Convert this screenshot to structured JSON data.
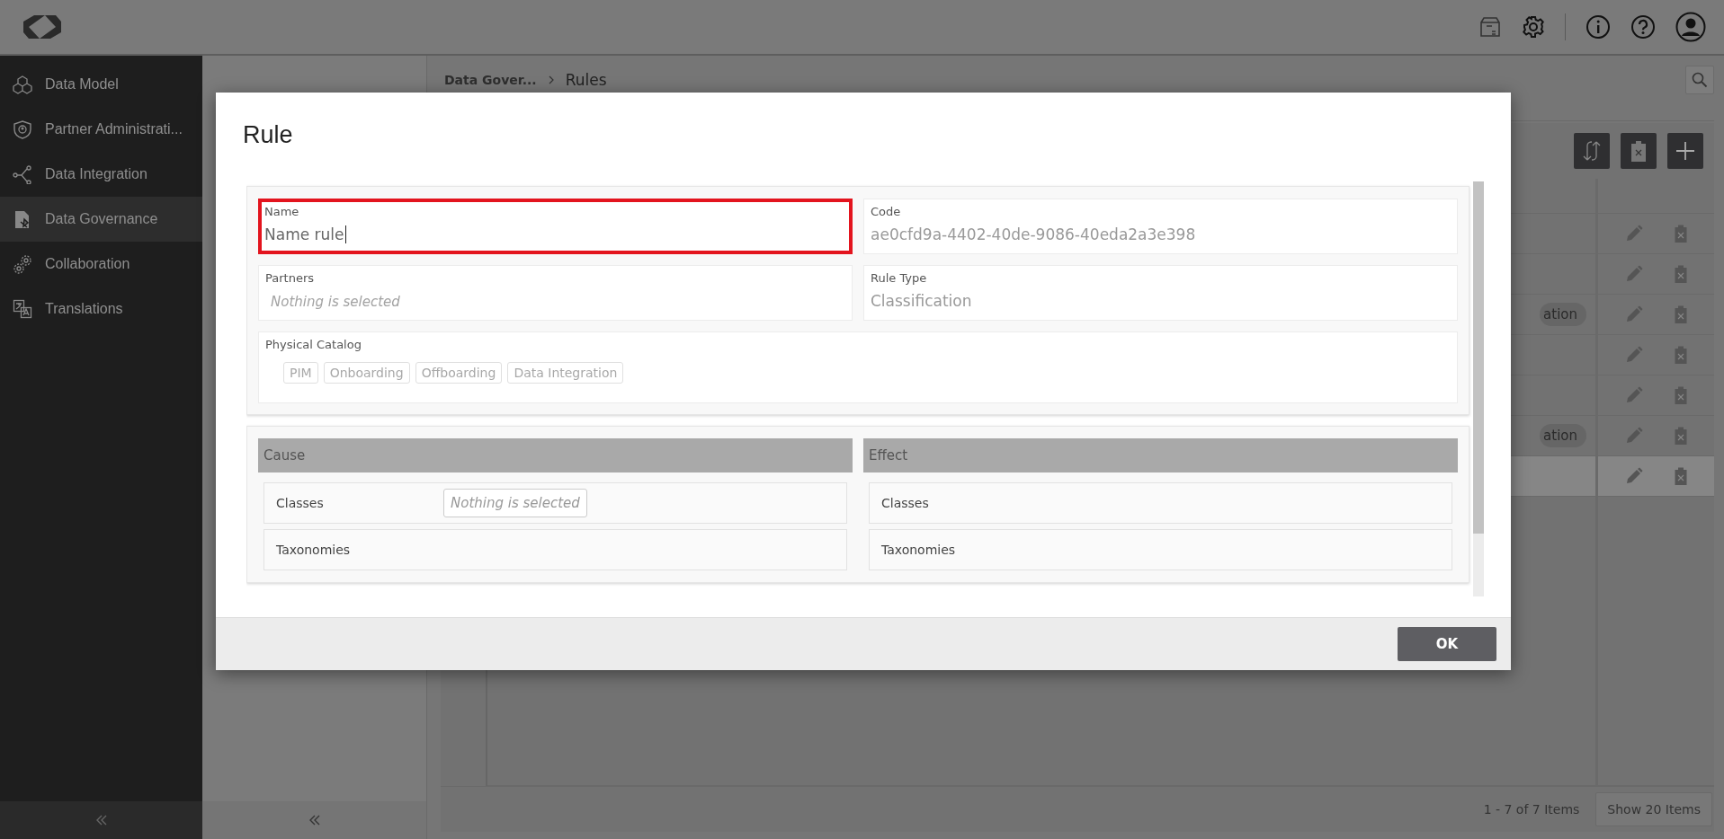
{
  "sidebar": {
    "items": [
      {
        "label": "Data Model",
        "selected": false
      },
      {
        "label": "Partner Administrati...",
        "selected": false
      },
      {
        "label": "Data Integration",
        "selected": false
      },
      {
        "label": "Data Governance",
        "selected": true
      },
      {
        "label": "Collaboration",
        "selected": false
      },
      {
        "label": "Translations",
        "selected": false
      }
    ]
  },
  "breadcrumb": [
    {
      "label": "Data Gover...",
      "current": false
    },
    {
      "label": "Rules",
      "current": true
    }
  ],
  "table": {
    "rows": [
      {
        "tag": null,
        "selected": false
      },
      {
        "tag": null,
        "selected": false
      },
      {
        "tag": "ation",
        "selected": false
      },
      {
        "tag": null,
        "selected": false
      },
      {
        "tag": null,
        "selected": false
      },
      {
        "tag": "ation",
        "selected": false
      },
      {
        "tag": null,
        "selected": true
      }
    ]
  },
  "pager": {
    "summary": "1 - 7 of 7 Items",
    "page_size_button": "Show 20 Items"
  },
  "dialog": {
    "title": "Rule",
    "fields": [
      {
        "kind": "text",
        "label": "Name",
        "value": "Name rule",
        "invalid": true,
        "focused": true
      },
      {
        "kind": "readonly",
        "label": "Code",
        "value": "ae0cfd9a-4402-40de-9086-40eda2a3e398",
        "invalid": false
      },
      {
        "kind": "select",
        "label": "Partners",
        "placeholder": "Nothing is selected",
        "invalid": false
      },
      {
        "kind": "readonly",
        "label": "Rule Type",
        "value": "Classification",
        "invalid": false
      },
      {
        "kind": "chips",
        "label": "Physical Catalog",
        "options": [
          {
            "label": "PIM",
            "selected": false
          },
          {
            "label": "Onboarding",
            "selected": false
          },
          {
            "label": "Offboarding",
            "selected": false
          },
          {
            "label": "Data Integration",
            "selected": false
          }
        ],
        "invalid": false
      }
    ],
    "sections": [
      {
        "title": "Cause",
        "rows": [
          {
            "label": "Classes",
            "placeholder": "Nothing is selected"
          },
          {
            "label": "Taxonomies"
          }
        ]
      },
      {
        "title": "Effect",
        "rows": [
          {
            "label": "Classes"
          },
          {
            "label": "Taxonomies"
          }
        ]
      }
    ],
    "ok_button": "OK"
  }
}
